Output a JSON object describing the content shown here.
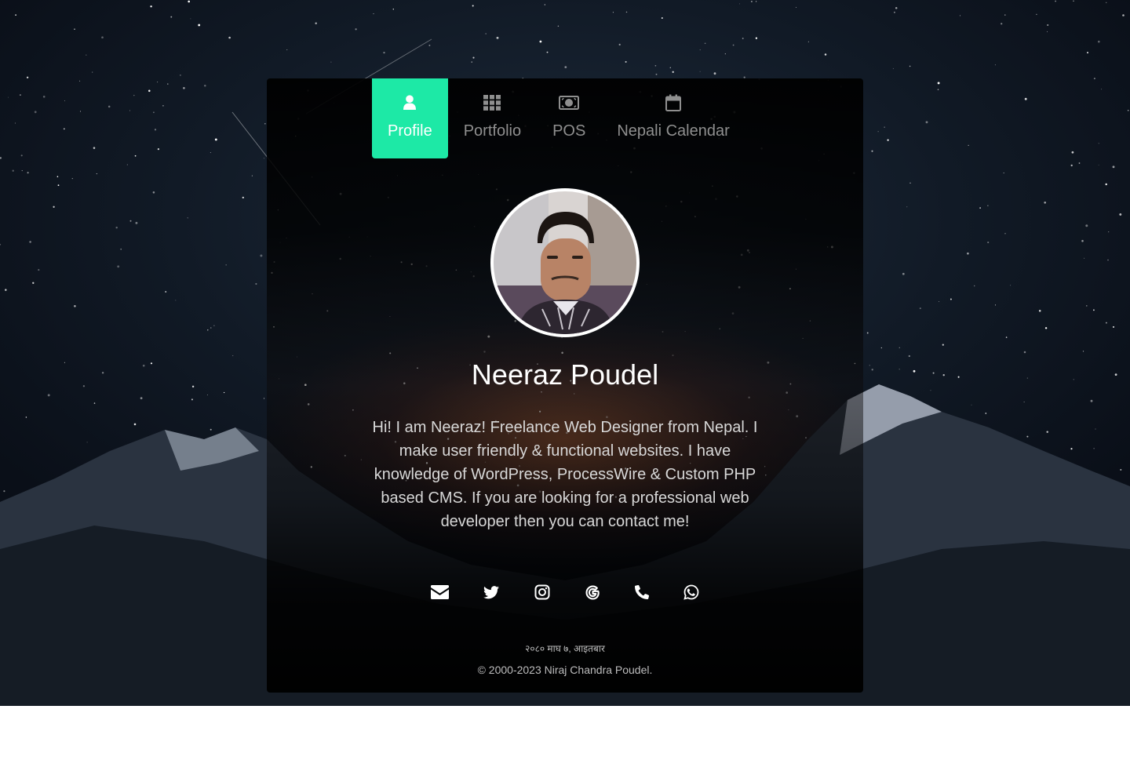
{
  "nav": {
    "items": [
      {
        "label": "Profile",
        "icon": "user-icon",
        "active": true
      },
      {
        "label": "Portfolio",
        "icon": "grid-icon",
        "active": false
      },
      {
        "label": "POS",
        "icon": "money-icon",
        "active": false
      },
      {
        "label": "Nepali Calendar",
        "icon": "calendar-icon",
        "active": false
      }
    ]
  },
  "profile": {
    "name": "Neeraz Poudel",
    "bio": "Hi! I am Neeraz! Freelance Web Designer from Nepal. I make user friendly & functional websites. I have knowledge of WordPress, ProcessWire & Custom PHP based CMS. If you are looking for a professional web developer then you can contact me!"
  },
  "social": [
    {
      "icon": "envelope-icon"
    },
    {
      "icon": "twitter-icon"
    },
    {
      "icon": "instagram-icon"
    },
    {
      "icon": "google-icon"
    },
    {
      "icon": "phone-icon"
    },
    {
      "icon": "whatsapp-icon"
    }
  ],
  "footer": {
    "date": "२०८० माघ ७, आइतबार",
    "copyright": "© 2000-2023 Niraj Chandra Poudel."
  },
  "colors": {
    "accent": "#1de9a6",
    "nav_inactive": "#8f8f8f",
    "text": "#ffffff"
  }
}
